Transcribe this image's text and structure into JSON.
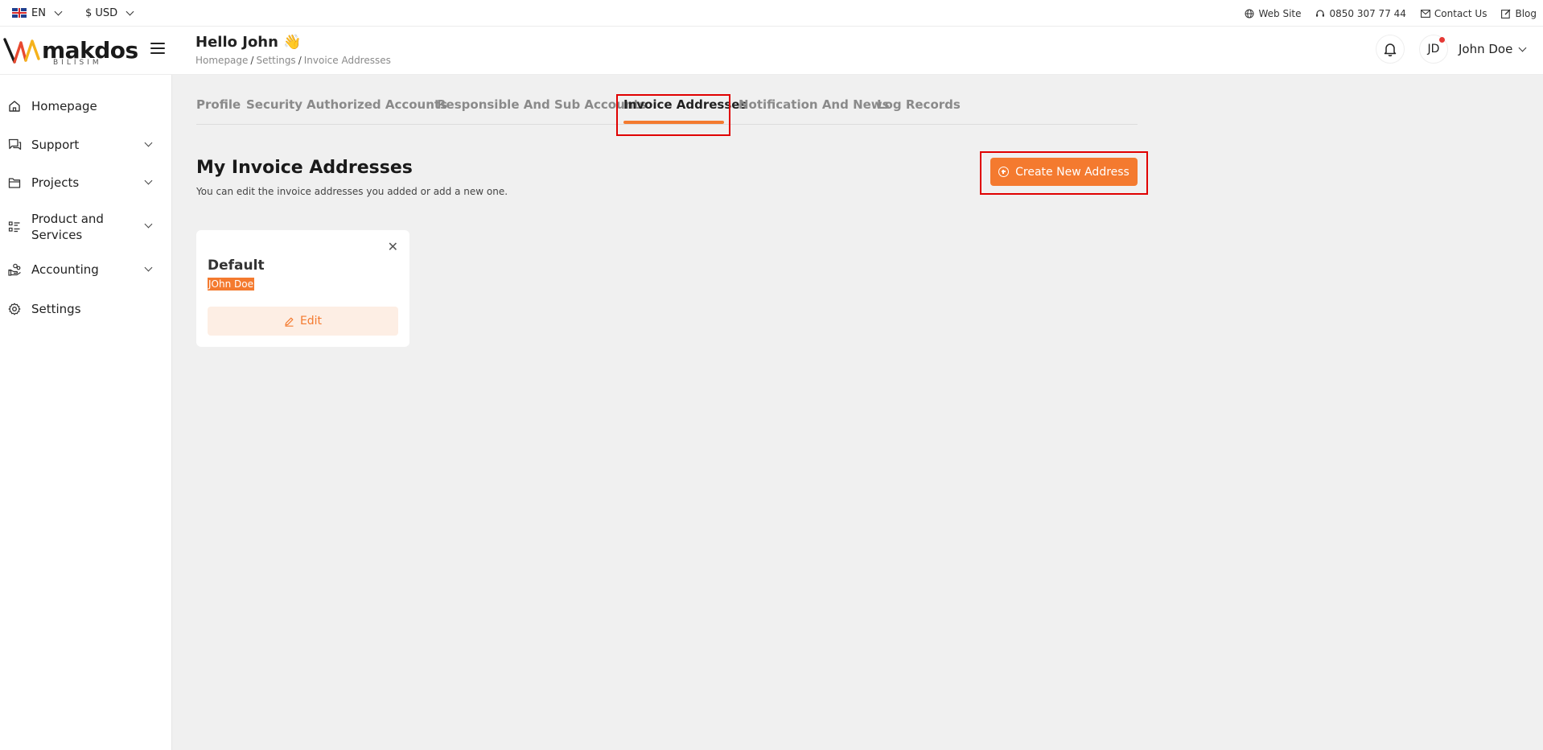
{
  "topbar": {
    "language": "EN",
    "currency": "$ USD",
    "links": {
      "website": "Web Site",
      "phone": "0850 307 77 44",
      "contact": "Contact Us",
      "blog": "Blog"
    }
  },
  "header": {
    "logo_word": "makdos",
    "logo_sub": "BILISIM",
    "greeting": "Hello John 👋",
    "breadcrumb": [
      "Homepage",
      "Settings",
      "Invoice Addresses"
    ],
    "avatar_initials": "JD",
    "user_name": "John Doe"
  },
  "sidebar": {
    "items": [
      {
        "label": "Homepage",
        "icon": "home-icon"
      },
      {
        "label": "Support",
        "icon": "chat-icon"
      },
      {
        "label": "Projects",
        "icon": "folder-icon"
      },
      {
        "label": "Product and Services",
        "icon": "list-icon"
      },
      {
        "label": "Accounting",
        "icon": "hand-coins-icon"
      },
      {
        "label": "Settings",
        "icon": "gear-icon"
      }
    ]
  },
  "tabs": [
    "Profile",
    "Security",
    "Authorized Accounts",
    "Responsible And Sub Accounts",
    "Invoice Addresses",
    "Notification And News",
    "Log Records"
  ],
  "active_tab": "Invoice Addresses",
  "main": {
    "title": "My Invoice Addresses",
    "subtitle": "You can edit the invoice addresses you added or add a new one.",
    "create_button": "Create New Address"
  },
  "address_card": {
    "name": "Default",
    "person": "JOhn Doe",
    "close_symbol": "✕",
    "edit_label": "Edit"
  },
  "colors": {
    "accent": "#f47a2f",
    "accent_light": "#fdeee4",
    "highlight": "#e00000",
    "background": "#f0f0f0"
  }
}
